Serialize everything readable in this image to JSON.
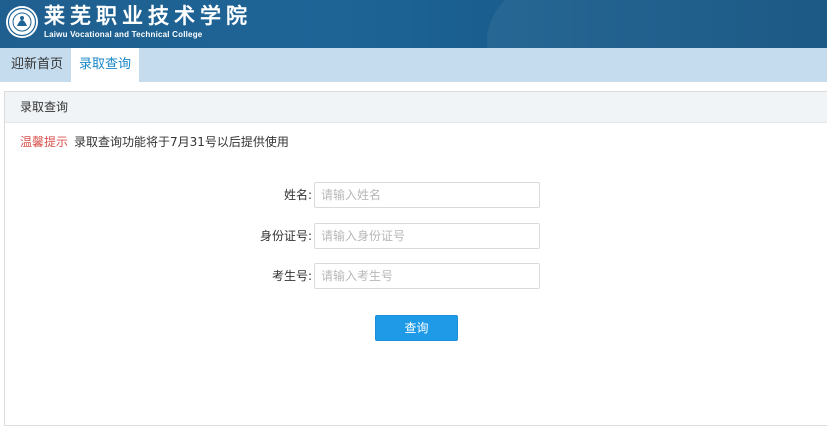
{
  "header": {
    "brand_cn": "莱芜职业技术学院",
    "brand_en": "Laiwu Vocational and Technical College",
    "logo_icon": "college-seal-icon",
    "colors": {
      "header_bg": "#1e6596",
      "nav_bg": "#c5dcee",
      "active_tab_text": "#1a86c8"
    }
  },
  "nav": {
    "tabs": [
      {
        "label": "迎新首页",
        "active": false
      },
      {
        "label": "录取查询",
        "active": true
      }
    ]
  },
  "panel": {
    "title": "录取查询",
    "notice": {
      "tip": "温馨提示",
      "message": "录取查询功能将于7月31号以后提供使用",
      "tip_color": "#d9534f"
    }
  },
  "form": {
    "name": {
      "label": "姓名:",
      "placeholder": "请输入姓名",
      "value": ""
    },
    "id_number": {
      "label": "身份证号:",
      "placeholder": "请输入身份证号",
      "value": ""
    },
    "exam_number": {
      "label": "考生号:",
      "placeholder": "请输入考生号",
      "value": ""
    },
    "submit_label": "查询",
    "submit_color": "#1e9ae6"
  }
}
